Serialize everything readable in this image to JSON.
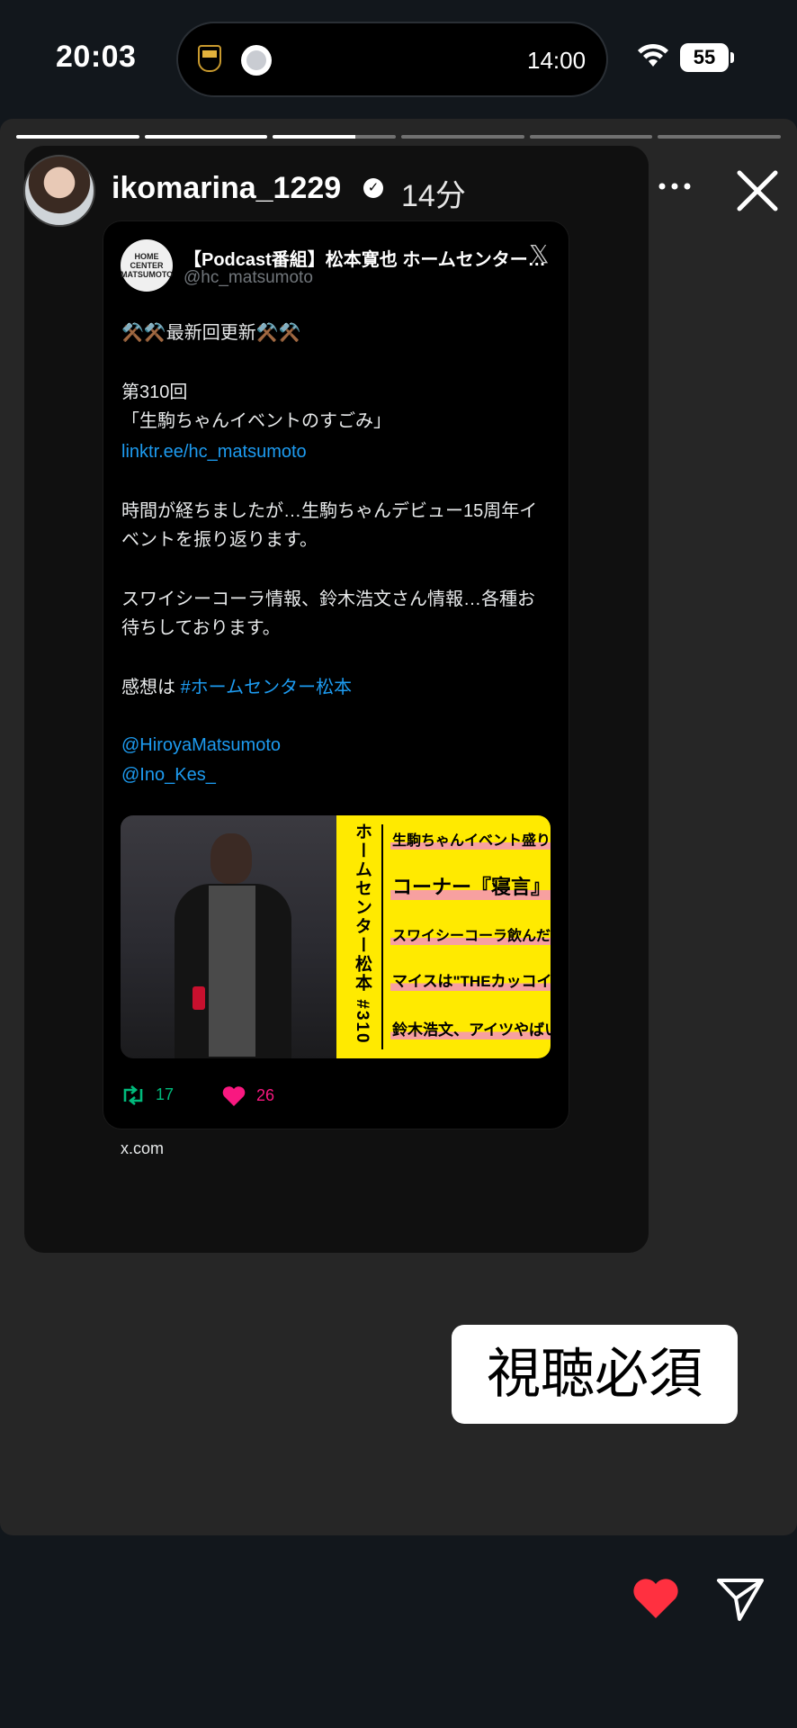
{
  "status_bar": {
    "time": "20:03",
    "island_time": "14:00",
    "battery": "55"
  },
  "story": {
    "username": "ikomarina_1229",
    "age": "14分",
    "verified_mark": "✓",
    "progress": [
      1.0,
      1.0,
      0.67,
      0,
      0,
      0
    ]
  },
  "tweet": {
    "avatar_text": "HOME\nCENTER\nMATSUMOTO",
    "name": "【Podcast番組】松本寛也 ホームセンター…",
    "handle": "@hc_matsumoto",
    "x_logo": "𝕏",
    "lines": [
      "⚒️⚒️最新回更新⚒️⚒️",
      "第310回",
      "「生駒ちゃんイベントのすごみ」",
      "linktr.ee/hc_matsumoto",
      "時間が経ちましたが…生駒ちゃんデビュー15周年イ",
      "ベントを振り返ります。",
      "スワイシーコーラ情報、鈴木浩文さん情報…各種お",
      "待ちしております。",
      "感想は ",
      "#ホームセンター松本",
      "@HiroyaMatsumoto",
      "@Ino_Kes_"
    ],
    "image_vertical_title": "ホームセンター松本 #310",
    "image_lines": [
      "生駒ちゃんイベント盛り上がった",
      "コーナー『寝言』",
      "スワイシーコーラ飲んだリスナー",
      "マイスは\"THEカッコイイ\"",
      "鈴木浩文、アイツやばいぞ"
    ],
    "retweets": "17",
    "likes": "26",
    "source": "x.com"
  },
  "sticker_text": "視聴必須",
  "icons": {
    "more": "more-horizontal-icon",
    "close": "close-icon",
    "like": "heart-icon",
    "share": "send-icon",
    "retweet": "retweet-icon"
  },
  "colors": {
    "link": "#1d9bf0",
    "heart": "#ff3040",
    "retweet": "#00ba7c",
    "like": "#f91880",
    "banner": "#ffea00"
  }
}
